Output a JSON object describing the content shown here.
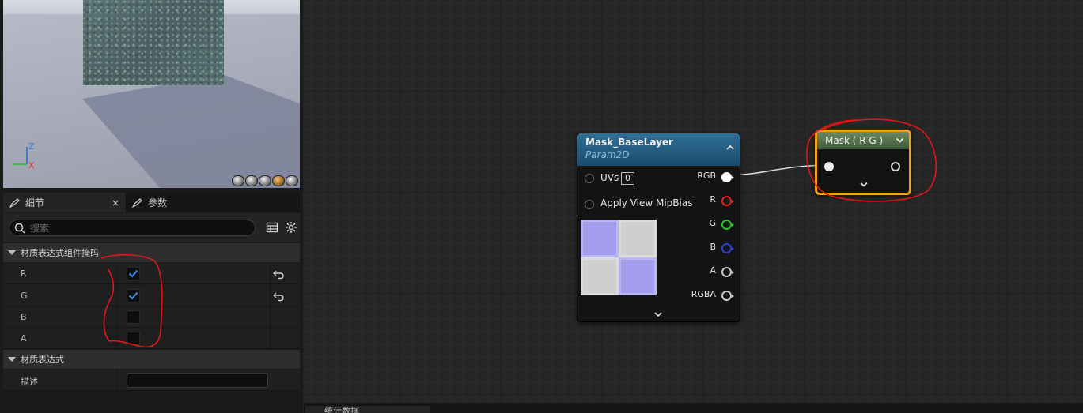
{
  "viewport": {
    "axis_z": "Z",
    "axis_x": "X"
  },
  "tabs": [
    {
      "label": "细节",
      "close": "×"
    },
    {
      "label": "参数"
    }
  ],
  "search": {
    "placeholder": "搜索"
  },
  "sections": [
    {
      "title": "材质表达式组件掩码",
      "rows": [
        {
          "name": "R",
          "checked": true,
          "reset": true
        },
        {
          "name": "G",
          "checked": true,
          "reset": true
        },
        {
          "name": "B",
          "checked": false,
          "reset": false
        },
        {
          "name": "A",
          "checked": false,
          "reset": false
        }
      ]
    },
    {
      "title": "材质表达式",
      "rows": [
        {
          "name": "描述",
          "value": ""
        }
      ]
    }
  ],
  "texture_node": {
    "title": "Mask_BaseLayer",
    "subtitle": "Param2D",
    "inputs": [
      {
        "label": "UVs",
        "value": "0"
      },
      {
        "label": "Apply View MipBias"
      }
    ],
    "outputs": [
      "RGB",
      "R",
      "G",
      "B",
      "A",
      "RGBA"
    ],
    "pin_colors": {
      "RGB": "#ffffff",
      "R": "#e02020",
      "G": "#22c722",
      "B": "#2a3fe0",
      "A": "#c8c8c8",
      "RGBA": "#c8c8c8"
    }
  },
  "mask_node": {
    "title": "Mask ( R G )",
    "selected_color": "#f2a01d"
  },
  "bottom_tab": {
    "label": "统计数据"
  },
  "annotation_color": "#e01818"
}
